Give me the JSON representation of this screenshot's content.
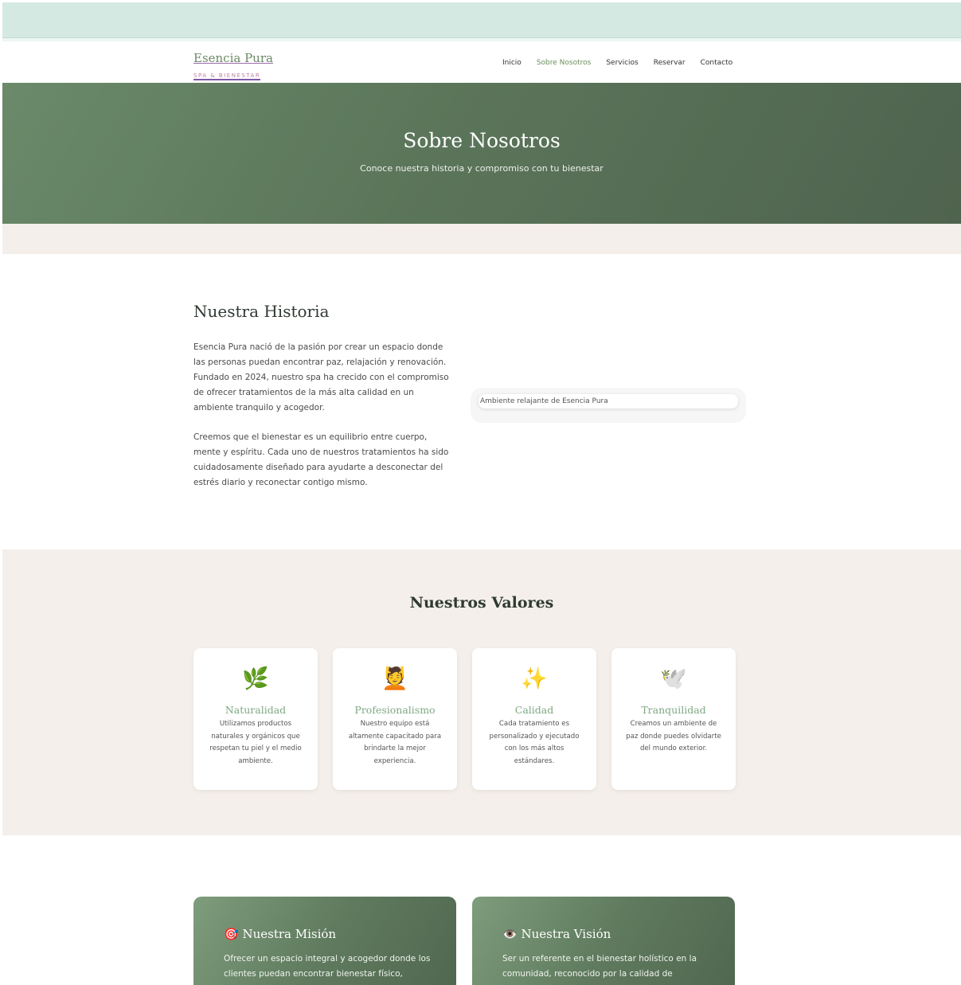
{
  "brand": {
    "title": "Esencia Pura",
    "subtitle": "SPA & BIENESTAR"
  },
  "nav": {
    "items": [
      "Inicio",
      "Sobre Nosotros",
      "Servicios",
      "Reservar",
      "Contacto"
    ],
    "active": "Sobre Nosotros"
  },
  "hero": {
    "title": "Sobre Nosotros",
    "subtitle": "Conoce nuestra historia y compromiso con tu bienestar"
  },
  "story": {
    "title": "Nuestra Historia",
    "p1": "Esencia Pura nació de la pasión por crear un espacio donde las personas puedan encontrar paz, relajación y renovación. Fundado en 2024, nuestro spa ha crecido con el compromiso de ofrecer tratamientos de la más alta calidad en un ambiente tranquilo y acogedor.",
    "p2": "Creemos que el bienestar es un equilibrio entre cuerpo, mente y espíritu. Cada uno de nuestros tratamientos ha sido cuidadosamente diseñado para ayudarte a desconectar del estrés diario y reconectar contigo mismo.",
    "image_alt": "Ambiente relajante de Esencia Pura"
  },
  "values": {
    "title": "Nuestros Valores",
    "cards": [
      {
        "icon": "🌿",
        "title": "Naturalidad",
        "text": "Utilizamos productos naturales y orgánicos que respetan tu piel y el medio ambiente."
      },
      {
        "icon": "💆",
        "title": "Profesionalismo",
        "text": "Nuestro equipo está altamente capacitado para brindarte la mejor experiencia."
      },
      {
        "icon": "✨",
        "title": "Calidad",
        "text": "Cada tratamiento es personalizado y ejecutado con los más altos estándares."
      },
      {
        "icon": "🕊️",
        "title": "Tranquilidad",
        "text": "Creamos un ambiente de paz donde puedes olvidarte del mundo exterior."
      }
    ]
  },
  "mission": {
    "icon": "🎯",
    "title": "Nuestra Misión",
    "text": "Ofrecer un espacio integral y acogedor donde los clientes puedan encontrar bienestar físico,"
  },
  "vision": {
    "icon": "👁️",
    "title": "Nuestra Visión",
    "text": "Ser un referente en el bienestar holístico en la comunidad, reconocido por la calidad de"
  }
}
